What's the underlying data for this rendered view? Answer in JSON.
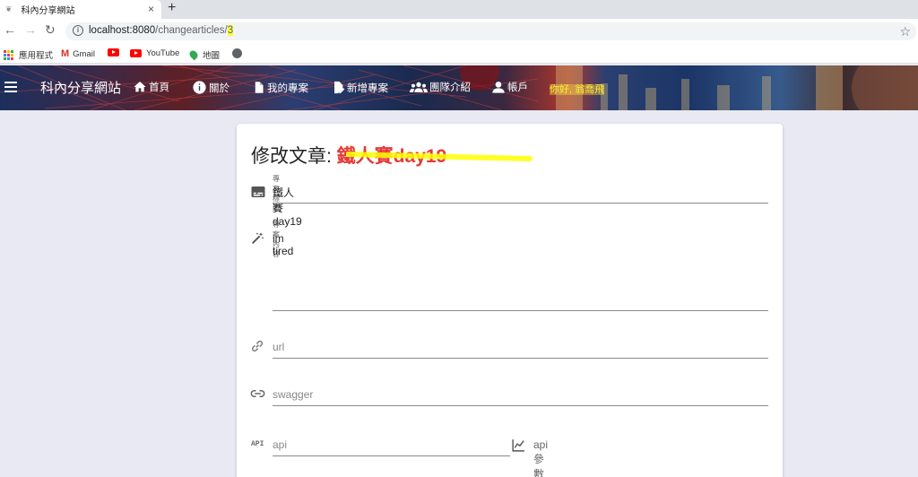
{
  "browser": {
    "tab_title": "科內分享網站",
    "new_tab": "+",
    "tab_close": "×",
    "url_host": "localhost:8080",
    "url_path": "/changearticles/",
    "url_id": "3",
    "bookmarks": [
      {
        "label": "應用程式",
        "icon": "apps-icon"
      },
      {
        "label": "Gmail",
        "icon": "gmail-icon"
      },
      {
        "label": "",
        "icon": "youtube-icon"
      },
      {
        "label": "YouTube",
        "icon": "youtube-icon"
      },
      {
        "label": "地圖",
        "icon": "maps-icon"
      },
      {
        "label": "",
        "icon": "globe-icon"
      }
    ]
  },
  "appbar": {
    "brand": "科內分享網站",
    "nav": [
      {
        "label": "首頁",
        "icon": "home-icon"
      },
      {
        "label": "關於",
        "icon": "info-icon"
      },
      {
        "label": "我的專案",
        "icon": "file-icon"
      },
      {
        "label": "新增專案",
        "icon": "file-edit-icon"
      },
      {
        "label": "團隊介紹",
        "icon": "group-icon"
      },
      {
        "label": "帳戶",
        "icon": "account-icon"
      }
    ],
    "greeting_prefix": "你好,",
    "greeting_name": "翁喬飛",
    "highlight_color": "#ffeb3b"
  },
  "form": {
    "title_prefix": "修改文章:",
    "title_name": "鐵人賽day19",
    "title_name_color": "#e53935",
    "fields": {
      "project_title": {
        "label": "專案標題",
        "value": "鐵人賽day19",
        "icon": "subtitles-icon"
      },
      "project_content": {
        "label": "專案內容",
        "value": "im tired",
        "icon": "magic-wand-icon"
      },
      "url": {
        "placeholder": "url",
        "icon": "link-icon"
      },
      "swagger": {
        "placeholder": "swagger",
        "icon": "link-variant-icon"
      },
      "api": {
        "placeholder": "api",
        "icon": "api-icon",
        "icon_text": "API"
      },
      "api_params": {
        "placeholder": "api參數",
        "icon": "chart-line-icon"
      }
    }
  }
}
